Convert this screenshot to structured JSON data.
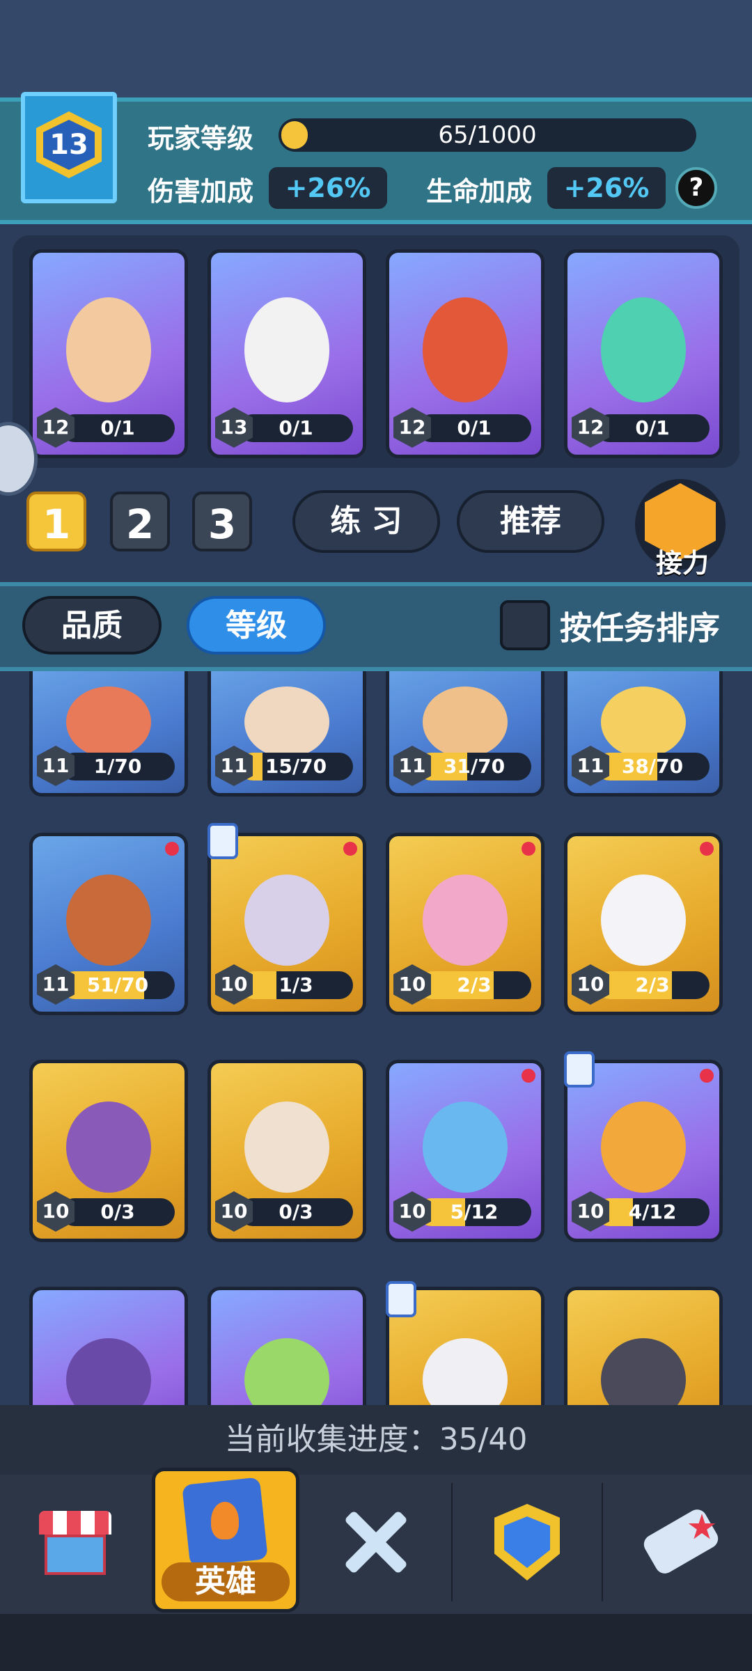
{
  "header": {
    "player_level": "13",
    "player_level_label": "玩家等级",
    "xp_text": "65/1000",
    "xp_fraction": 0.065,
    "damage_bonus_label": "伤害加成",
    "damage_bonus_value": "+26%",
    "hp_bonus_label": "生命加成",
    "hp_bonus_value": "+26%",
    "help_label": "?"
  },
  "team": [
    {
      "level": "12",
      "progress": "0/1"
    },
    {
      "level": "13",
      "progress": "0/1"
    },
    {
      "level": "12",
      "progress": "0/1"
    },
    {
      "level": "12",
      "progress": "0/1"
    }
  ],
  "slots": [
    "1",
    "2",
    "3"
  ],
  "buttons": {
    "practice": "练 习",
    "recommend": "推荐",
    "relay": "接力"
  },
  "filters": {
    "quality": "品质",
    "level": "等级",
    "sort_by_task": "按任务排序"
  },
  "heroes": [
    {
      "level": "11",
      "progress": "1/70",
      "fill": 0.014
    },
    {
      "level": "11",
      "progress": "15/70",
      "fill": 0.21
    },
    {
      "level": "11",
      "progress": "31/70",
      "fill": 0.44
    },
    {
      "level": "11",
      "progress": "38/70",
      "fill": 0.54
    },
    {
      "level": "11",
      "progress": "51/70",
      "fill": 0.73
    },
    {
      "level": "10",
      "progress": "1/3",
      "fill": 0.33
    },
    {
      "level": "10",
      "progress": "2/3",
      "fill": 0.67
    },
    {
      "level": "10",
      "progress": "2/3",
      "fill": 0.67
    },
    {
      "level": "10",
      "progress": "0/3",
      "fill": 0
    },
    {
      "level": "10",
      "progress": "0/3",
      "fill": 0
    },
    {
      "level": "10",
      "progress": "5/12",
      "fill": 0.42
    },
    {
      "level": "10",
      "progress": "4/12",
      "fill": 0.33
    }
  ],
  "collection": "当前收集进度：35/40",
  "nav": {
    "active_label": "英雄"
  }
}
